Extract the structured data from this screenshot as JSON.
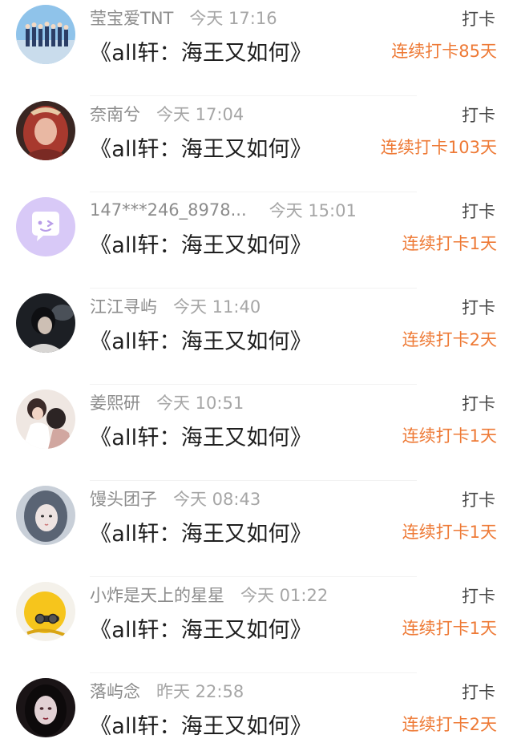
{
  "colors": {
    "streak": "#ee7a36",
    "username": "#8c8c8c",
    "title": "#1f1f1f",
    "action": "#444444"
  },
  "entries": [
    {
      "avatar": "group-photo-avatar",
      "username": "莹宝爱TNT",
      "time": "今天 17:16",
      "title": "《all轩：海王又如何》",
      "action": "打卡",
      "streak": "连续打卡85天"
    },
    {
      "avatar": "red-hair-girl-avatar",
      "username": "奈南兮",
      "time": "今天 17:04",
      "title": "《all轩：海王又如何》",
      "action": "打卡",
      "streak": "连续打卡103天"
    },
    {
      "avatar": "default-chat-avatar",
      "username": "147***246_8978...",
      "time": "今天 15:01",
      "title": "《all轩：海王又如何》",
      "action": "打卡",
      "streak": "连续打卡1天"
    },
    {
      "avatar": "dark-portrait-avatar",
      "username": "江江寻屿",
      "time": "今天 11:40",
      "title": "《all轩：海王又如何》",
      "action": "打卡",
      "streak": "连续打卡2天"
    },
    {
      "avatar": "couple-illustration-avatar",
      "username": "姜熙研",
      "time": "今天 10:51",
      "title": "《all轩：海王又如何》",
      "action": "打卡",
      "streak": "连续打卡1天"
    },
    {
      "avatar": "anime-girl-avatar",
      "username": "馒头团子",
      "time": "今天 08:43",
      "title": "《all轩：海王又如何》",
      "action": "打卡",
      "streak": "连续打卡1天"
    },
    {
      "avatar": "yellow-chick-avatar",
      "username": "小炸是天上的星星",
      "time": "今天 01:22",
      "title": "《all轩：海王又如何》",
      "action": "打卡",
      "streak": "连续打卡1天"
    },
    {
      "avatar": "gothic-girl-avatar",
      "username": "落屿念",
      "time": "昨天 22:58",
      "title": "《all轩：海王又如何》",
      "action": "打卡",
      "streak": "连续打卡2天"
    }
  ]
}
